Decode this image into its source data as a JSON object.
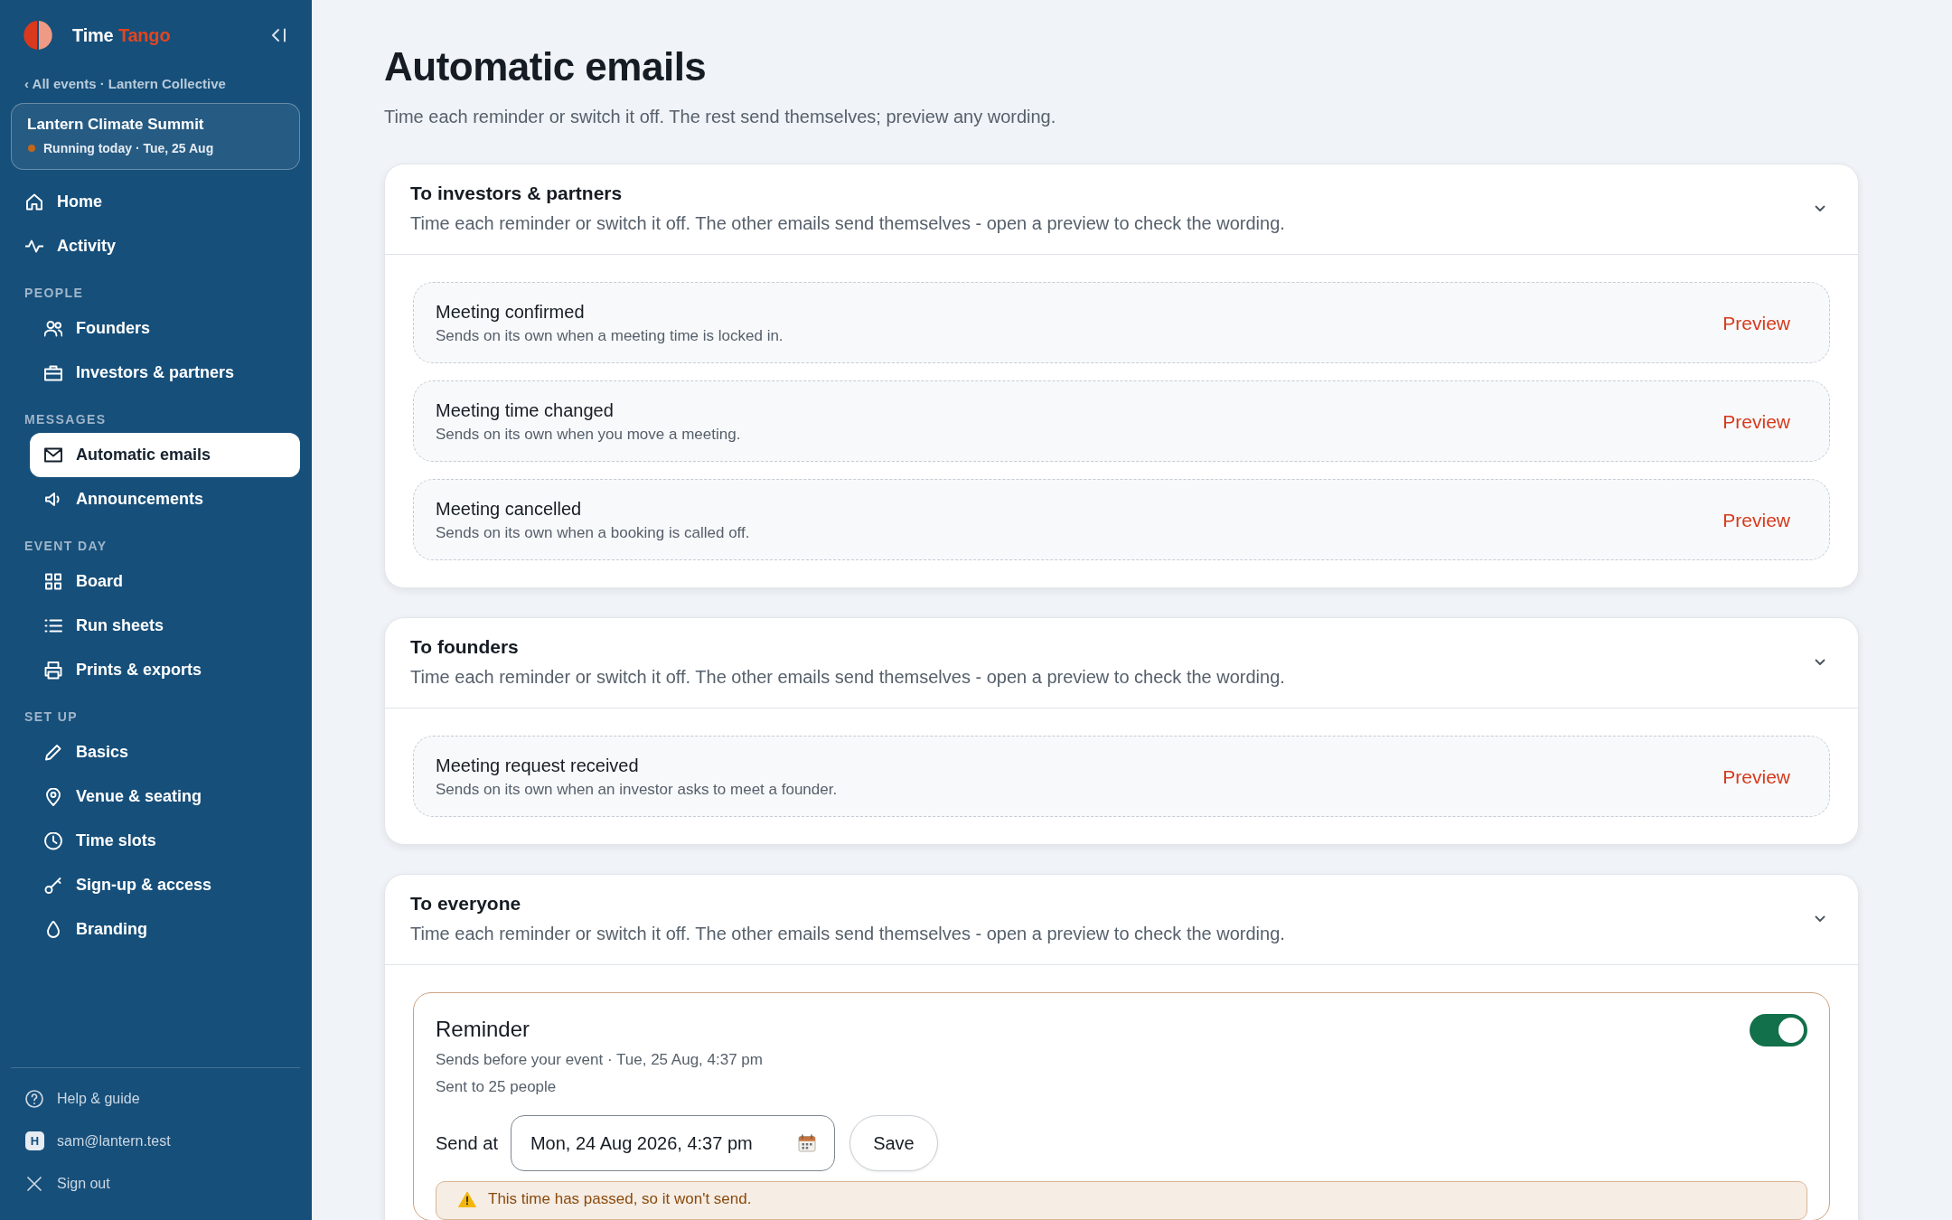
{
  "sidebar": {
    "brand": {
      "name": "Time",
      "accent": "Tango"
    },
    "back_link": "‹ All events · Lantern Collective",
    "event": {
      "name": "Lantern Climate Summit",
      "status": "Running today · Tue, 25 Aug"
    },
    "nav_groups": [
      {
        "items": [
          {
            "label": "Home",
            "selected": false
          },
          {
            "label": "Activity",
            "selected": false
          }
        ]
      },
      {
        "heading": "PEOPLE",
        "items": [
          {
            "label": "Founders",
            "selected": false
          },
          {
            "label": "Investors & partners",
            "selected": false
          }
        ]
      },
      {
        "heading": "MESSAGES",
        "items": [
          {
            "label": "Automatic emails",
            "selected": true
          },
          {
            "label": "Announcements",
            "selected": false
          }
        ]
      },
      {
        "heading": "EVENT DAY",
        "items": [
          {
            "label": "Board",
            "selected": false
          },
          {
            "label": "Run sheets",
            "selected": false
          },
          {
            "label": "Prints & exports",
            "selected": false
          }
        ]
      },
      {
        "heading": "SET UP",
        "items": [
          {
            "label": "Basics",
            "selected": false
          },
          {
            "label": "Venue & seating",
            "selected": false
          },
          {
            "label": "Time slots",
            "selected": false
          },
          {
            "label": "Sign-up & access",
            "selected": false
          },
          {
            "label": "Branding",
            "selected": false
          }
        ]
      }
    ],
    "footer": [
      {
        "kind": "help",
        "label": "Help & guide"
      },
      {
        "kind": "account",
        "avatar": "H",
        "label": "sam@lantern.test"
      },
      {
        "kind": "sign_out",
        "label": "Sign out"
      }
    ]
  },
  "page": {
    "title": "Automatic emails",
    "subtitle": "Time each reminder or switch it off. The rest send themselves; preview any wording."
  },
  "groups": [
    {
      "title": "To investors & partners",
      "description": "Time each reminder or switch it off. The other emails send themselves - open a preview to check the wording.",
      "expanded": true,
      "emails": [
        {
          "kind": "automatic",
          "title": "Meeting confirmed",
          "description": "Sends on its own when a meeting time is locked in.",
          "action": "Preview"
        },
        {
          "kind": "automatic",
          "title": "Meeting time changed",
          "description": "Sends on its own when you move a meeting.",
          "action": "Preview"
        },
        {
          "kind": "automatic",
          "title": "Meeting cancelled",
          "description": "Sends on its own when a booking is called off.",
          "action": "Preview"
        }
      ]
    },
    {
      "title": "To founders",
      "description": "Time each reminder or switch it off. The other emails send themselves - open a preview to check the wording.",
      "expanded": true,
      "emails": [
        {
          "kind": "automatic",
          "title": "Meeting request received",
          "description": "Sends on its own when an investor asks to meet a founder.",
          "action": "Preview"
        }
      ]
    },
    {
      "title": "To everyone",
      "description": "Time each reminder or switch it off. The other emails send themselves - open a preview to check the wording.",
      "expanded": true,
      "emails": [
        {
          "kind": "reminder",
          "title": "Reminder",
          "description": "Sends before your event · Tue, 25 Aug, 4:37 pm",
          "audience": "Sent to 25 people",
          "on": true,
          "send_at": {
            "label": "Send at",
            "value": "Mon, 24 Aug 2026, 4:37 pm"
          },
          "save": "Save",
          "warning": "This time has passed, so it won't send."
        }
      ]
    }
  ]
}
